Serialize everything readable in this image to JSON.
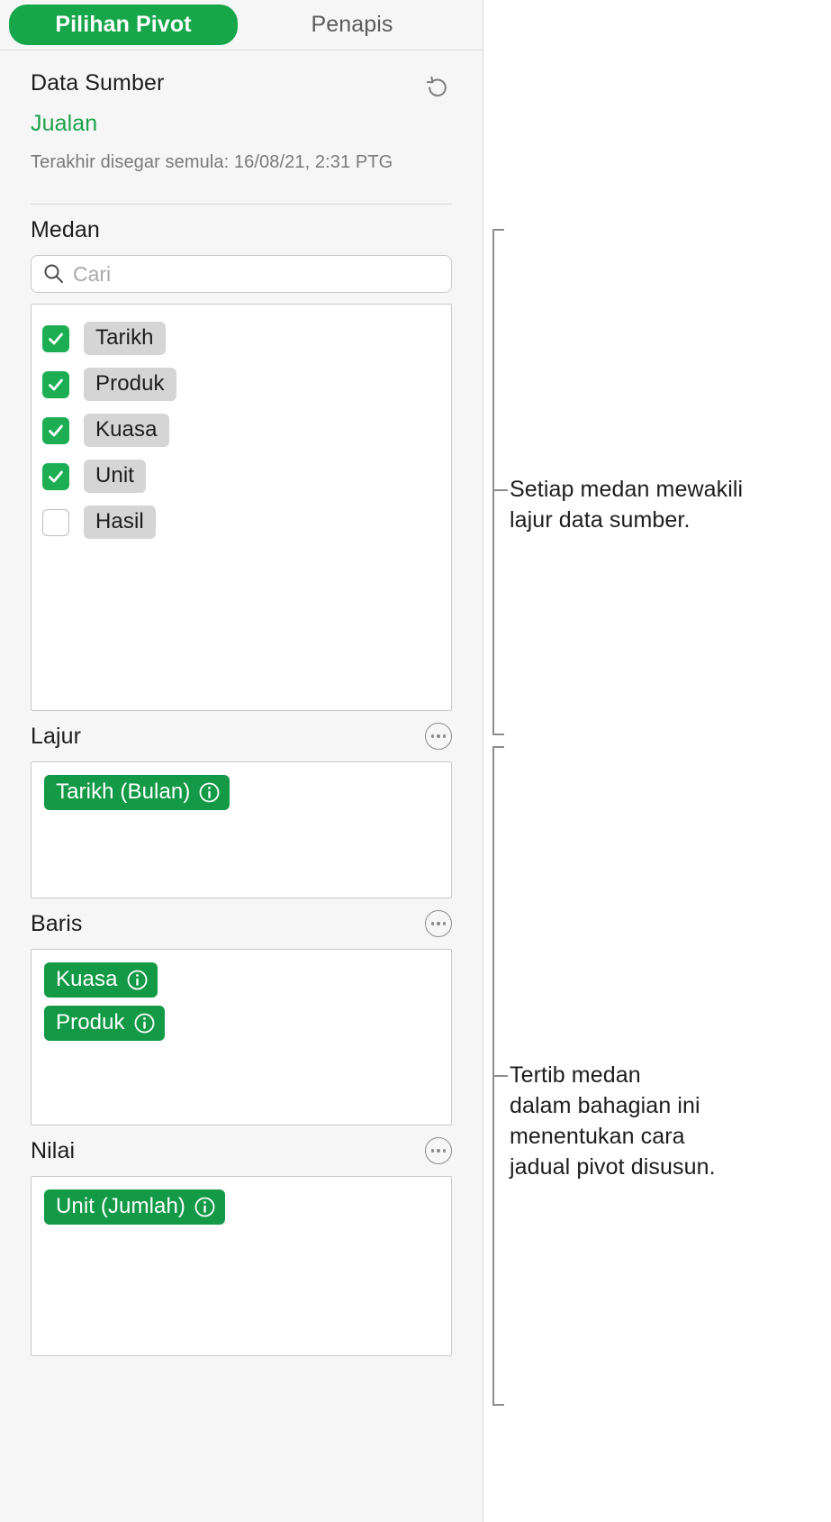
{
  "tabs": [
    {
      "label": "Pilihan Pivot",
      "active": true
    },
    {
      "label": "Penapis",
      "active": false
    }
  ],
  "source": {
    "title": "Data Sumber",
    "name": "Jualan",
    "updated": "Terakhir disegar semula: 16/08/21, 2:31 PTG",
    "refresh_icon": "refresh-icon"
  },
  "fields": {
    "label": "Medan",
    "search_placeholder": "Cari",
    "search_value": "",
    "search_icon": "search-icon",
    "items": [
      {
        "label": "Tarikh",
        "checked": true
      },
      {
        "label": "Produk",
        "checked": true
      },
      {
        "label": "Kuasa",
        "checked": true
      },
      {
        "label": "Unit",
        "checked": true
      },
      {
        "label": "Hasil",
        "checked": false
      }
    ]
  },
  "columns": {
    "label": "Lajur",
    "more_icon": "more-options-icon",
    "tokens": [
      {
        "label": "Tarikh (Bulan)",
        "info_icon": "info-icon"
      }
    ]
  },
  "rows": {
    "label": "Baris",
    "more_icon": "more-options-icon",
    "tokens": [
      {
        "label": "Kuasa",
        "info_icon": "info-icon"
      },
      {
        "label": "Produk",
        "info_icon": "info-icon"
      }
    ]
  },
  "values": {
    "label": "Nilai",
    "more_icon": "more-options-icon",
    "tokens": [
      {
        "label": "Unit (Jumlah)",
        "info_icon": "info-icon"
      }
    ]
  },
  "callouts": [
    {
      "text": "Setiap medan mewakili\nlajur data sumber."
    },
    {
      "text": "Tertib medan\ndalam bahagian ini\nmenentukan cara\njadual pivot disusun."
    }
  ],
  "colors": {
    "accent_green": "#17a64a",
    "token_green": "#149a46",
    "check_green": "#1dae54",
    "panel_bg": "#f6f6f6",
    "pill_gray": "#d5d5d5"
  }
}
